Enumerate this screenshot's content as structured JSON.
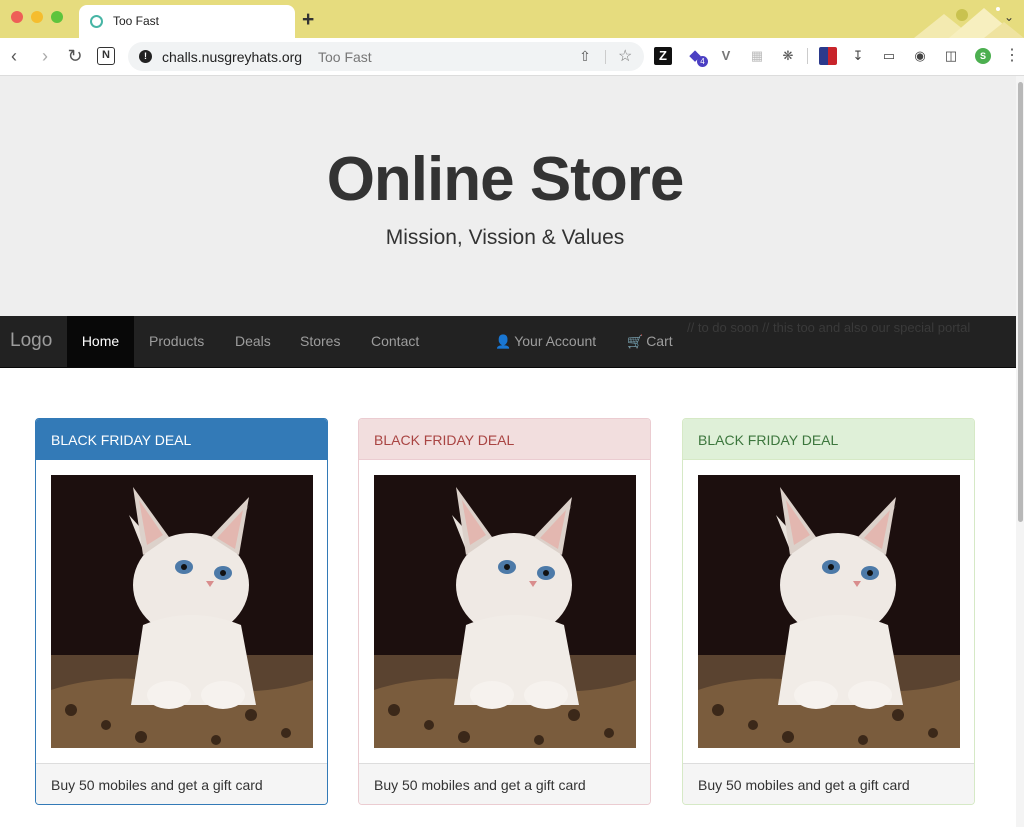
{
  "browser": {
    "tab_title": "Too Fast",
    "new_tab_label": "+",
    "url_host": "challs.nusgreyhats.org",
    "url_page_title": "Too Fast",
    "icons": [
      "back-icon",
      "forward-icon",
      "reload-icon",
      "notion-icon",
      "site-info-icon",
      "share-icon",
      "star-icon",
      "zotero-icon",
      "extension-icon",
      "vue-icon",
      "grid-icon",
      "puzzle-icon",
      "flag-icon",
      "download-icon",
      "cast-icon",
      "camera-icon",
      "side-panel-icon",
      "avatar-icon",
      "menu-icon"
    ],
    "extension_badge": "4",
    "avatar_letter": "S"
  },
  "jumbotron": {
    "title": "Online Store",
    "subtitle": "Mission, Vission & Values"
  },
  "navbar": {
    "brand": "Logo",
    "items": [
      {
        "label": "Home",
        "active": true
      },
      {
        "label": "Products"
      },
      {
        "label": "Deals"
      },
      {
        "label": "Stores"
      },
      {
        "label": "Contact"
      }
    ],
    "right_items": [
      {
        "label": "Your Account",
        "icon": "user-icon"
      },
      {
        "label": "Cart",
        "icon": "cart-icon"
      }
    ],
    "hidden_comment": "// to do soon // this too and also our special portal"
  },
  "deals": [
    {
      "heading": "BLACK FRIDAY DEAL",
      "image": "white kitten",
      "footer": "Buy 50 mobiles and get a gift card",
      "accent": "#337ab7"
    },
    {
      "heading": "BLACK FRIDAY DEAL",
      "image": "white kitten",
      "footer": "Buy 50 mobiles and get a gift card",
      "accent": "#a94442"
    },
    {
      "heading": "BLACK FRIDAY DEAL",
      "image": "white kitten",
      "footer": "Buy 50 mobiles and get a gift card",
      "accent": "#3c763d"
    }
  ]
}
